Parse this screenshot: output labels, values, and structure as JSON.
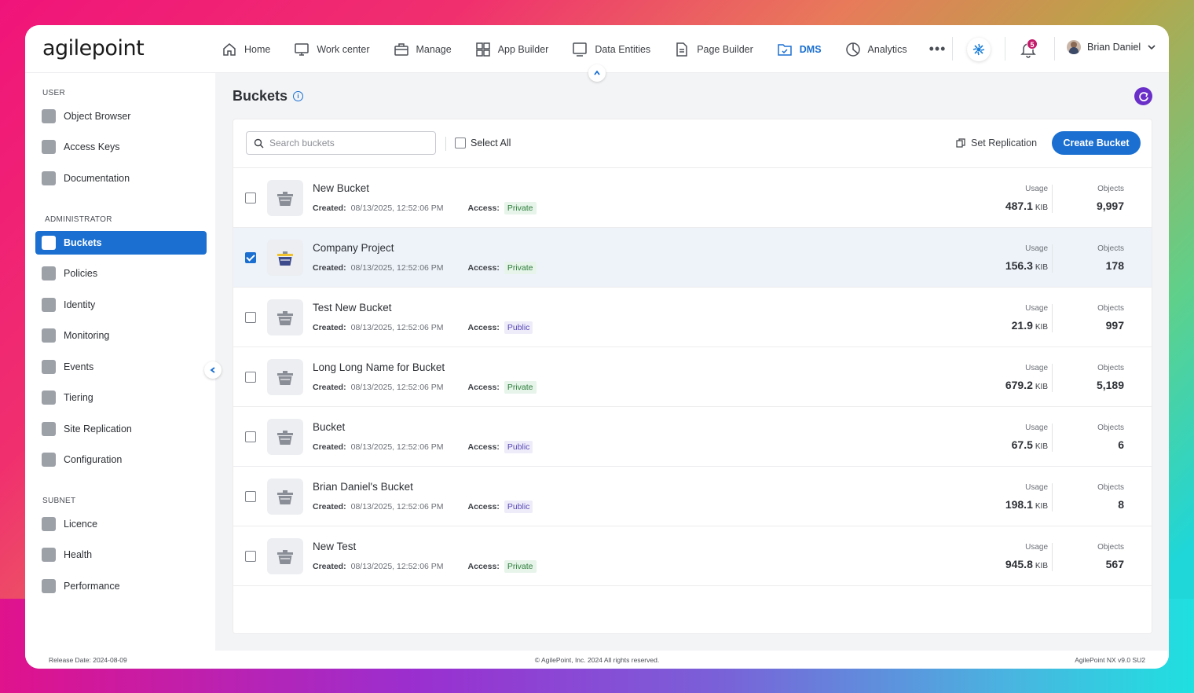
{
  "brand": {
    "logo_text": "agilepoint"
  },
  "nav": {
    "items": [
      {
        "label": "Home",
        "icon": "home-icon"
      },
      {
        "label": "Work center",
        "icon": "monitor-icon"
      },
      {
        "label": "Manage",
        "icon": "briefcase-icon"
      },
      {
        "label": "App Builder",
        "icon": "grid-icon"
      },
      {
        "label": "Data Entities",
        "icon": "screen-icon"
      },
      {
        "label": "Page Builder",
        "icon": "page-icon"
      },
      {
        "label": "DMS",
        "icon": "folder-icon",
        "active": true
      },
      {
        "label": "Analytics",
        "icon": "pie-chart-icon"
      }
    ],
    "more": "•••",
    "notifications_count": "5",
    "user_name": "Brian Daniel"
  },
  "sidebar": {
    "sections": [
      {
        "title": "USER",
        "items": [
          "Object Browser",
          "Access Keys",
          "Documentation"
        ]
      },
      {
        "title": "ADMINISTRATOR",
        "items": [
          "Buckets",
          "Policies",
          "Identity",
          "Monitoring",
          "Events",
          "Tiering",
          "Site Replication",
          "Configuration"
        ]
      },
      {
        "title": "SUBNET",
        "items": [
          "Licence",
          "Health",
          "Performance"
        ]
      }
    ],
    "active_item": "Buckets"
  },
  "page": {
    "title": "Buckets",
    "info_icon": "i"
  },
  "toolbar": {
    "search_placeholder": "Search buckets",
    "select_all": "Select All",
    "set_replication": "Set Replication",
    "create_bucket": "Create Bucket"
  },
  "labels": {
    "created": "Created:",
    "access": "Access:",
    "usage": "Usage",
    "objects": "Objects",
    "unit": "KIB"
  },
  "buckets": [
    {
      "name": "New Bucket",
      "created": "08/13/2025, 12:52:06 PM",
      "access": "Private",
      "usage": "487.1",
      "objects": "9,997",
      "selected": false
    },
    {
      "name": "Company Project",
      "created": "08/13/2025, 12:52:06 PM",
      "access": "Private",
      "usage": "156.3",
      "objects": "178",
      "selected": true
    },
    {
      "name": "Test New Bucket",
      "created": "08/13/2025, 12:52:06 PM",
      "access": "Public",
      "usage": "21.9",
      "objects": "997",
      "selected": false
    },
    {
      "name": "Long Long Name for Bucket",
      "created": "08/13/2025, 12:52:06 PM",
      "access": "Private",
      "usage": "679.2",
      "objects": "5,189",
      "selected": false
    },
    {
      "name": "Bucket",
      "created": "08/13/2025, 12:52:06 PM",
      "access": "Public",
      "usage": "67.5",
      "objects": "6",
      "selected": false
    },
    {
      "name": "Brian Daniel's Bucket",
      "created": "08/13/2025, 12:52:06 PM",
      "access": "Public",
      "usage": "198.1",
      "objects": "8",
      "selected": false
    },
    {
      "name": "New Test",
      "created": "08/13/2025, 12:52:06 PM",
      "access": "Private",
      "usage": "945.8",
      "objects": "567",
      "selected": false
    }
  ],
  "footer": {
    "release": "Release Date: 2024-08-09",
    "copyright": "© AgilePoint, Inc. 2024 All rights reserved.",
    "version": "AgilePoint NX v9.0 SU2"
  },
  "colors": {
    "accent": "#1a6fd0",
    "private_badge": "#2e7d3a",
    "public_badge": "#5a4ab8",
    "refresh": "#6a2fc8"
  }
}
